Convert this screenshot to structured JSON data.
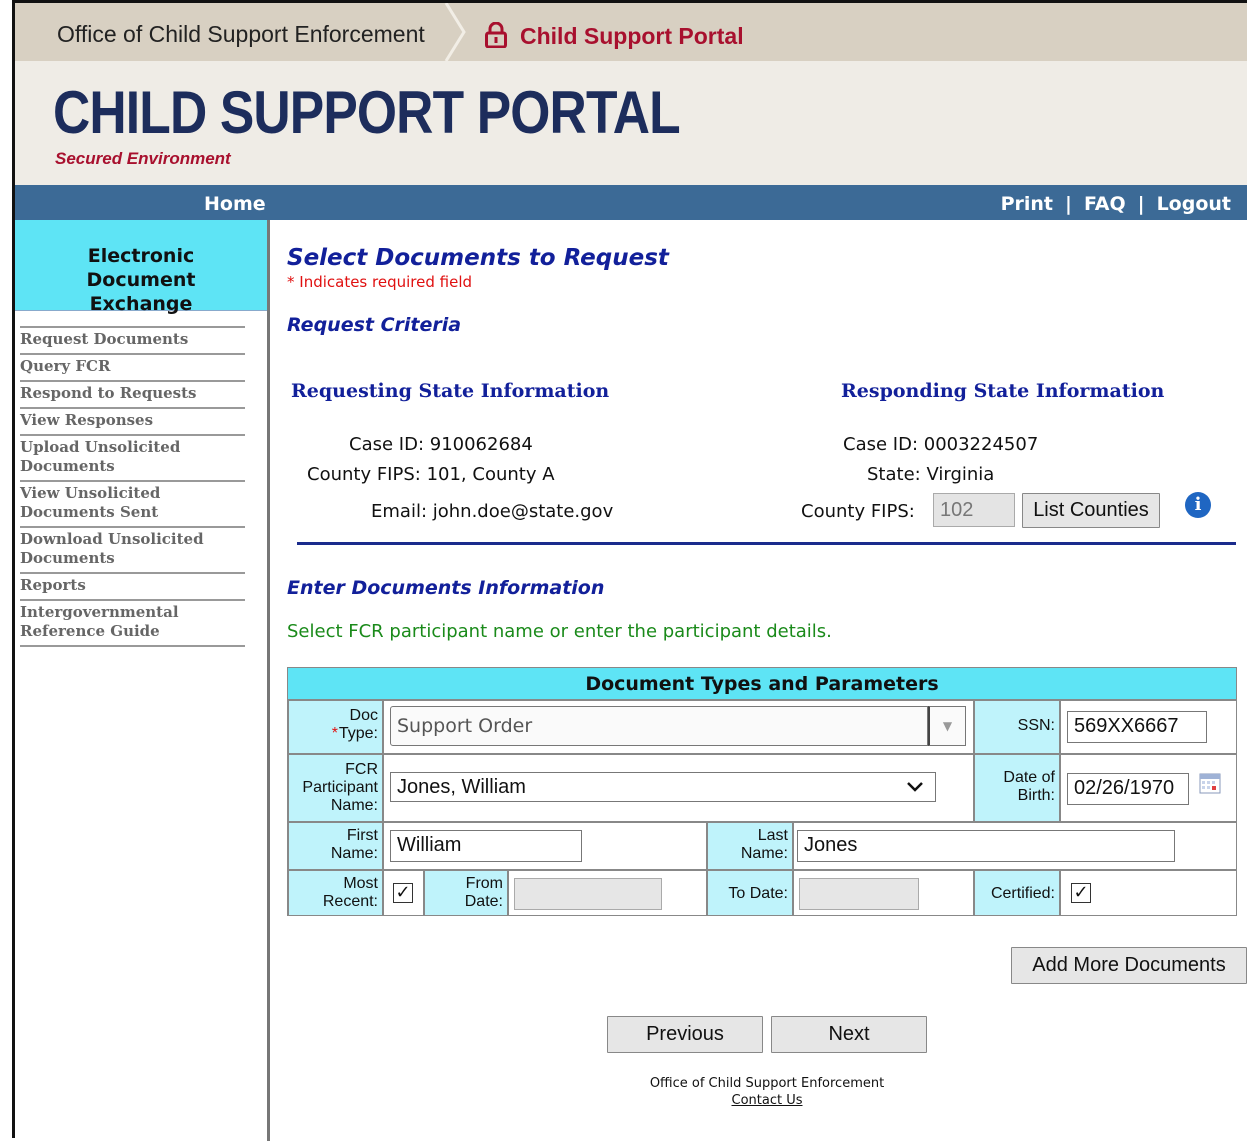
{
  "breadcrumb": {
    "office": "Office of Child Support Enforcement",
    "portal": "Child Support Portal"
  },
  "banner": {
    "title": "CHILD SUPPORT PORTAL",
    "subtitle": "Secured Environment"
  },
  "nav": {
    "home": "Home",
    "print": "Print",
    "faq": "FAQ",
    "logout": "Logout",
    "separator": "|"
  },
  "sidebar": {
    "heading": "Electronic Document Exchange",
    "items": [
      {
        "label": "Request Documents"
      },
      {
        "label": "Query FCR"
      },
      {
        "label": "Respond to Requests"
      },
      {
        "label": "View Responses"
      },
      {
        "label": "Upload Unsolicited Documents"
      },
      {
        "label": "View Unsolicited Documents Sent"
      },
      {
        "label": "Download Unsolicited Documents"
      },
      {
        "label": "Reports"
      },
      {
        "label": "Intergovernmental Reference Guide"
      }
    ]
  },
  "page": {
    "title": "Select Documents to Request",
    "required_note": "* Indicates required field",
    "criteria_title": "Request Criteria"
  },
  "requesting": {
    "title": "Requesting State Information",
    "case_id_label": "Case ID:",
    "case_id": "910062684",
    "county_fips_label": "County FIPS:",
    "county_fips": "101, County A",
    "email_label": "Email:",
    "email": "john.doe@state.gov"
  },
  "responding": {
    "title": "Responding State Information",
    "case_id_label": "Case ID:",
    "case_id": "0003224507",
    "state_label": "State:",
    "state": "Virginia",
    "county_fips_label": "County FIPS:",
    "county_fips": "102",
    "list_counties_button": "List Counties"
  },
  "documents": {
    "title": "Enter Documents Information",
    "instruction": "Select FCR participant name or enter the participant details.",
    "table_header": "Document Types and Parameters",
    "doc_type_required_mark": "*",
    "doc_type_label": "Doc Type:",
    "doc_type_value": "Support Order",
    "ssn_label": "SSN:",
    "ssn_value": "569XX6667",
    "fcr_label": "FCR Participant Name:",
    "fcr_value": "Jones, William",
    "dob_label": "Date of Birth:",
    "dob_value": "02/26/1970",
    "first_name_label": "First Name:",
    "first_name_value": "William",
    "last_name_label": "Last Name:",
    "last_name_value": "Jones",
    "most_recent_label": "Most Recent:",
    "most_recent_checked": true,
    "from_date_label": "From Date:",
    "from_date_value": "",
    "to_date_label": "To Date:",
    "to_date_value": "",
    "certified_label": "Certified:",
    "certified_checked": true,
    "check_mark": "✓"
  },
  "actions": {
    "add_more": "Add More Documents",
    "previous": "Previous",
    "next": "Next"
  },
  "footer": {
    "org": "Office of Child Support Enforcement",
    "contact": "Contact Us"
  },
  "colors": {
    "nav_bar": "#3c6a96",
    "brand_red": "#a8102e",
    "heading_blue": "#12209a",
    "cyan_header": "#5ee4f5",
    "cyan_label": "#bff3fb",
    "instruction_green": "#1a8a1a"
  }
}
